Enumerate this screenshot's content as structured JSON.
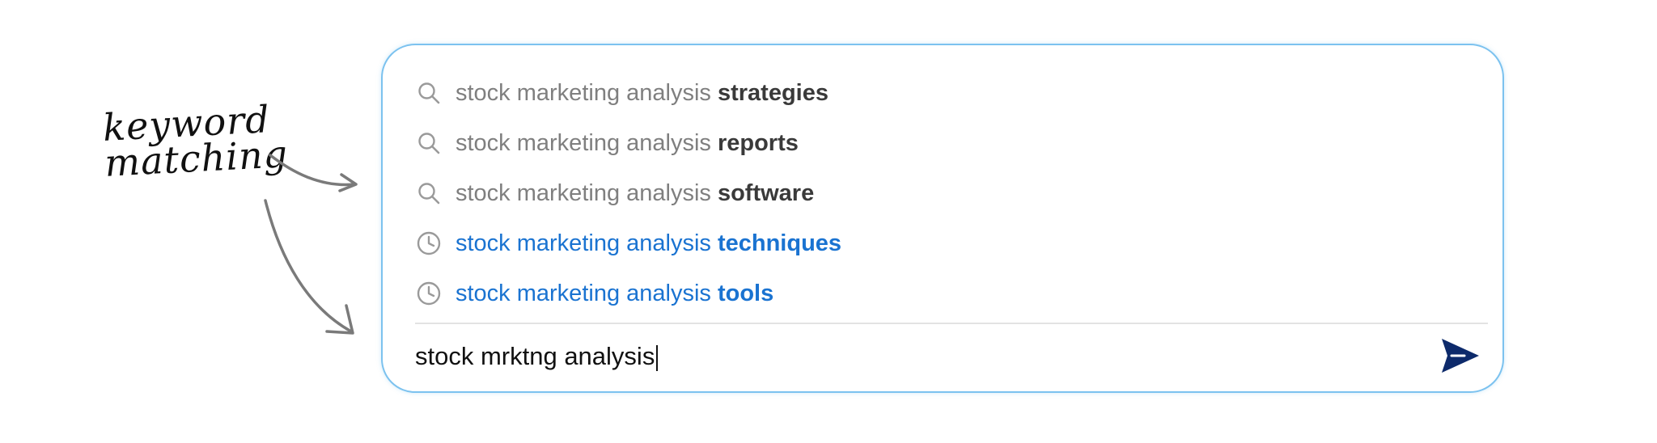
{
  "annotation": {
    "text": "keyword\nmatching"
  },
  "suggestions": [
    {
      "type": "search",
      "icon": "search-icon",
      "prefix": "stock marketing analysis ",
      "suffix": "strategies"
    },
    {
      "type": "search",
      "icon": "search-icon",
      "prefix": "stock marketing analysis ",
      "suffix": "reports"
    },
    {
      "type": "search",
      "icon": "search-icon",
      "prefix": "stock marketing analysis ",
      "suffix": "software"
    },
    {
      "type": "history",
      "icon": "clock-icon",
      "prefix": "stock marketing analysis ",
      "suffix": "techniques"
    },
    {
      "type": "history",
      "icon": "clock-icon",
      "prefix": "stock marketing analysis ",
      "suffix": "tools"
    }
  ],
  "input": {
    "value": "stock mrktng analysis"
  },
  "send_button": {
    "icon": "send-icon"
  },
  "colors": {
    "border": "#7cc2ef",
    "history_text": "#1a73d1",
    "suggestion_gray": "#7f7f7f",
    "suggestion_bold": "#3a3a3a",
    "send_icon": "#0d2a6b"
  }
}
